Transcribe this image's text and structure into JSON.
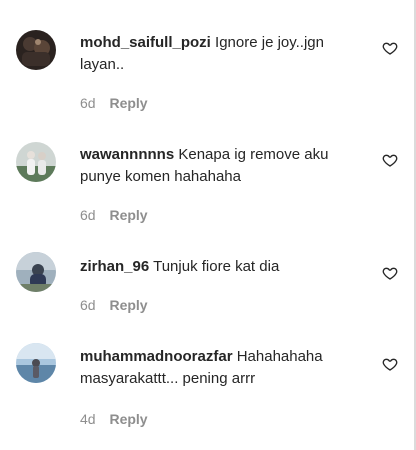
{
  "comments": [
    {
      "username": "mohd_saifull_pozi",
      "text": "Ignore je joy..jgn layan..",
      "age": "6d",
      "reply": "Reply"
    },
    {
      "username": "wawannnnns",
      "text": "Kenapa ig remove aku punye komen hahahaha",
      "age": "6d",
      "reply": "Reply"
    },
    {
      "username": "zirhan_96",
      "text": "Tunjuk fiore kat dia",
      "age": "6d",
      "reply": "Reply"
    },
    {
      "username": "muhammadnoorazfar",
      "text": "Hahahahaha masyarakattt... pening arrr",
      "age": "4d",
      "reply": "Reply"
    }
  ]
}
